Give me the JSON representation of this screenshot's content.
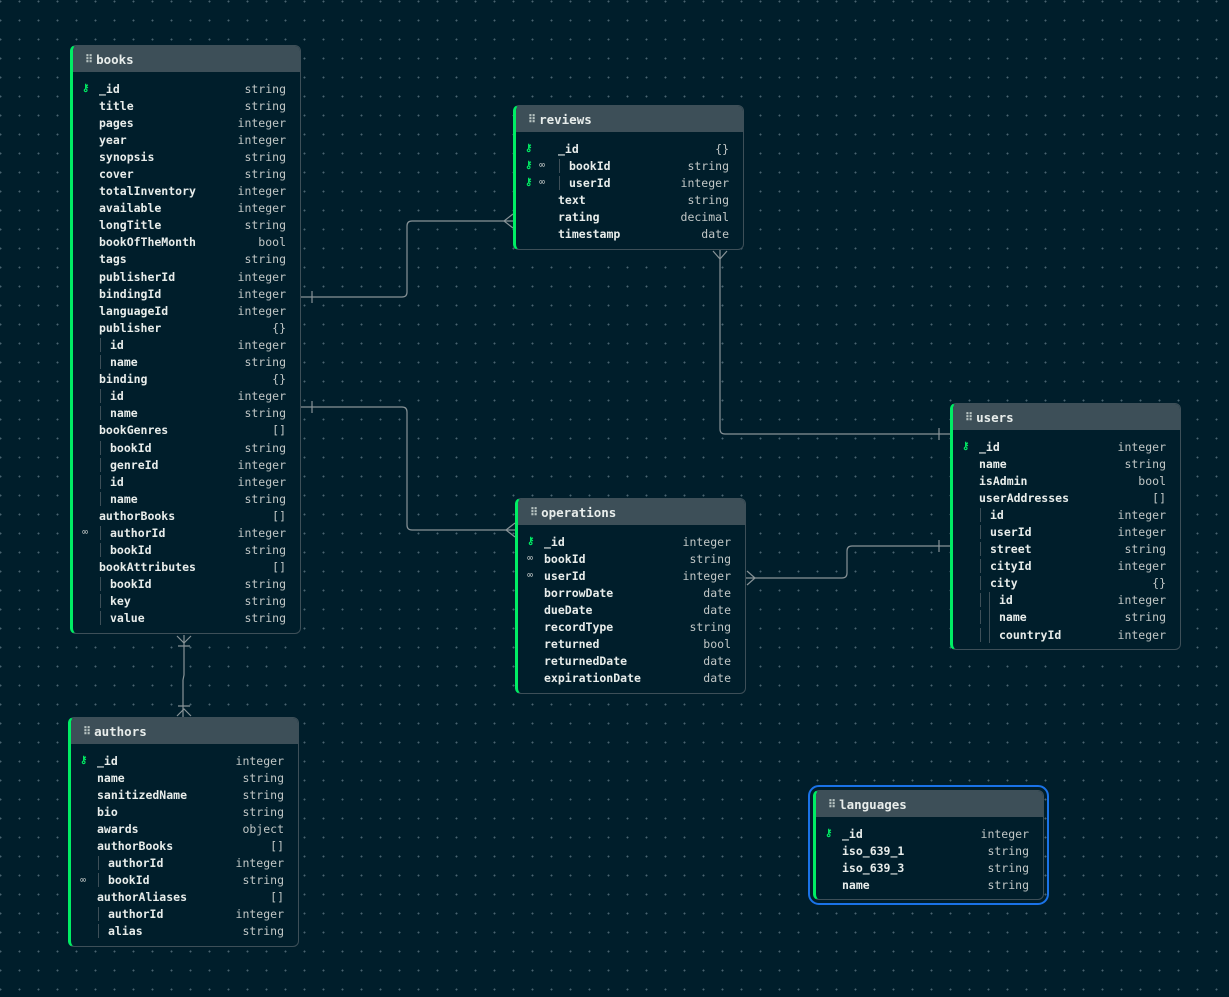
{
  "colors": {
    "background": "#001e2b",
    "accent": "#00ed64",
    "header": "#3d4f58",
    "edge": "#889397",
    "selection": "#1a73e8"
  },
  "icons": {
    "drag": "grip-icon",
    "primary_key": "key-icon",
    "foreign_key": "link-icon"
  },
  "tables": {
    "books": {
      "name": "books",
      "fields": [
        {
          "name": "_id",
          "type": "string",
          "pk": true
        },
        {
          "name": "title",
          "type": "string"
        },
        {
          "name": "pages",
          "type": "integer"
        },
        {
          "name": "year",
          "type": "integer"
        },
        {
          "name": "synopsis",
          "type": "string"
        },
        {
          "name": "cover",
          "type": "string"
        },
        {
          "name": "totalInventory",
          "type": "integer"
        },
        {
          "name": "available",
          "type": "integer"
        },
        {
          "name": "longTitle",
          "type": "string"
        },
        {
          "name": "bookOfTheMonth",
          "type": "bool"
        },
        {
          "name": "tags",
          "type": "string"
        },
        {
          "name": "publisherId",
          "type": "integer"
        },
        {
          "name": "bindingId",
          "type": "integer"
        },
        {
          "name": "languageId",
          "type": "integer"
        },
        {
          "name": "publisher",
          "type": "{}"
        },
        {
          "name": "id",
          "type": "integer",
          "depth": 1
        },
        {
          "name": "name",
          "type": "string",
          "depth": 1
        },
        {
          "name": "binding",
          "type": "{}"
        },
        {
          "name": "id",
          "type": "integer",
          "depth": 1
        },
        {
          "name": "name",
          "type": "string",
          "depth": 1
        },
        {
          "name": "bookGenres",
          "type": "[]"
        },
        {
          "name": "bookId",
          "type": "string",
          "depth": 1
        },
        {
          "name": "genreId",
          "type": "integer",
          "depth": 1
        },
        {
          "name": "id",
          "type": "integer",
          "depth": 1
        },
        {
          "name": "name",
          "type": "string",
          "depth": 1
        },
        {
          "name": "authorBooks",
          "type": "[]"
        },
        {
          "name": "authorId",
          "type": "integer",
          "depth": 1,
          "fk": true
        },
        {
          "name": "bookId",
          "type": "string",
          "depth": 1
        },
        {
          "name": "bookAttributes",
          "type": "[]"
        },
        {
          "name": "bookId",
          "type": "string",
          "depth": 1
        },
        {
          "name": "key",
          "type": "string",
          "depth": 1
        },
        {
          "name": "value",
          "type": "string",
          "depth": 1
        }
      ]
    },
    "reviews": {
      "name": "reviews",
      "fields": [
        {
          "name": "_id",
          "type": "{}",
          "pk": true
        },
        {
          "name": "bookId",
          "type": "string",
          "depth": 1,
          "pk": true,
          "fk": true
        },
        {
          "name": "userId",
          "type": "integer",
          "depth": 1,
          "pk": true,
          "fk": true
        },
        {
          "name": "text",
          "type": "string"
        },
        {
          "name": "rating",
          "type": "decimal"
        },
        {
          "name": "timestamp",
          "type": "date"
        }
      ]
    },
    "operations": {
      "name": "operations",
      "fields": [
        {
          "name": "_id",
          "type": "integer",
          "pk": true
        },
        {
          "name": "bookId",
          "type": "string",
          "fk": true
        },
        {
          "name": "userId",
          "type": "integer",
          "fk": true
        },
        {
          "name": "borrowDate",
          "type": "date"
        },
        {
          "name": "dueDate",
          "type": "date"
        },
        {
          "name": "recordType",
          "type": "string"
        },
        {
          "name": "returned",
          "type": "bool"
        },
        {
          "name": "returnedDate",
          "type": "date"
        },
        {
          "name": "expirationDate",
          "type": "date"
        }
      ]
    },
    "users": {
      "name": "users",
      "fields": [
        {
          "name": "_id",
          "type": "integer",
          "pk": true
        },
        {
          "name": "name",
          "type": "string"
        },
        {
          "name": "isAdmin",
          "type": "bool"
        },
        {
          "name": "userAddresses",
          "type": "[]"
        },
        {
          "name": "id",
          "type": "integer",
          "depth": 1
        },
        {
          "name": "userId",
          "type": "integer",
          "depth": 1
        },
        {
          "name": "street",
          "type": "string",
          "depth": 1
        },
        {
          "name": "cityId",
          "type": "integer",
          "depth": 1
        },
        {
          "name": "city",
          "type": "{}",
          "depth": 1
        },
        {
          "name": "id",
          "type": "integer",
          "depth": 2
        },
        {
          "name": "name",
          "type": "string",
          "depth": 2
        },
        {
          "name": "countryId",
          "type": "integer",
          "depth": 2
        }
      ]
    },
    "authors": {
      "name": "authors",
      "fields": [
        {
          "name": "_id",
          "type": "integer",
          "pk": true
        },
        {
          "name": "name",
          "type": "string"
        },
        {
          "name": "sanitizedName",
          "type": "string"
        },
        {
          "name": "bio",
          "type": "string"
        },
        {
          "name": "awards",
          "type": "object"
        },
        {
          "name": "authorBooks",
          "type": "[]"
        },
        {
          "name": "authorId",
          "type": "integer",
          "depth": 1
        },
        {
          "name": "bookId",
          "type": "string",
          "depth": 1,
          "fk": true
        },
        {
          "name": "authorAliases",
          "type": "[]"
        },
        {
          "name": "authorId",
          "type": "integer",
          "depth": 1
        },
        {
          "name": "alias",
          "type": "string",
          "depth": 1
        }
      ]
    },
    "languages": {
      "name": "languages",
      "selected": true,
      "fields": [
        {
          "name": "_id",
          "type": "integer",
          "pk": true
        },
        {
          "name": "iso_639_1",
          "type": "string"
        },
        {
          "name": "iso_639_3",
          "type": "string"
        },
        {
          "name": "name",
          "type": "string"
        }
      ]
    }
  },
  "relationships": [
    {
      "from": "books",
      "to": "reviews",
      "cardinality": "one-to-many"
    },
    {
      "from": "books",
      "to": "operations",
      "cardinality": "one-to-many"
    },
    {
      "from": "reviews",
      "to": "users",
      "cardinality": "many-to-one"
    },
    {
      "from": "operations",
      "to": "users",
      "cardinality": "many-to-one"
    },
    {
      "from": "books",
      "to": "authors",
      "cardinality": "many-to-many"
    }
  ]
}
